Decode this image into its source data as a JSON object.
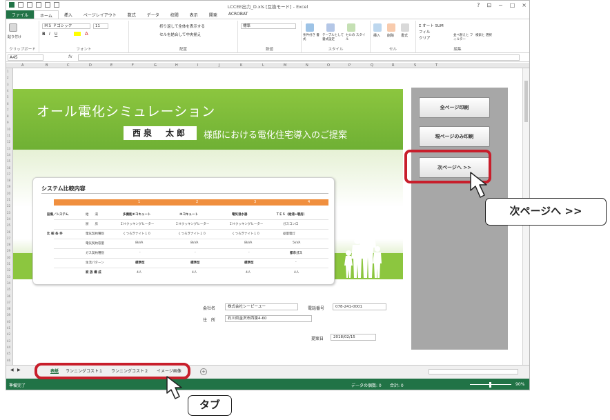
{
  "window": {
    "title": "LCCEE出力_D.xls [互換モード] - Excel",
    "controls": [
      "?",
      "⊡",
      "−",
      "□",
      "×"
    ]
  },
  "ribbon": {
    "tabs": [
      "ファイル",
      "ホーム",
      "挿入",
      "ページレイアウト",
      "数式",
      "データ",
      "校閲",
      "表示",
      "開発",
      "ACROBAT"
    ],
    "font_name": "ＭＳ Ｐゴシック",
    "font_size": "11",
    "number_format": "標準",
    "wrap_text": "折り返して全体を表示する",
    "merge_center": "セルを結合して中央揃え",
    "autosum": "オート SUM",
    "fill": "フィル",
    "clear": "クリア",
    "sort_filter": "並べ替えと フィルター",
    "find_select": "検索と 選択",
    "cond_format": "条件付き 書式",
    "format_table": "テーブルとして 書式設定",
    "cell_styles": "セルの スタイル",
    "insert": "挿入",
    "delete": "削除",
    "format": "書式",
    "groups": [
      "クリップボード",
      "フォント",
      "配置",
      "数値",
      "スタイル",
      "セル",
      "編集"
    ],
    "paste": "貼り付け"
  },
  "formula_bar": {
    "name_box": "A45",
    "fx": "fx",
    "value": ""
  },
  "column_headers": [
    "A",
    "B",
    "C",
    "D",
    "E",
    "F",
    "G",
    "H",
    "I",
    "J",
    "K",
    "L",
    "M",
    "N",
    "O",
    "P",
    "Q",
    "R",
    "S",
    "T"
  ],
  "row_numbers": [
    "1",
    "2",
    "3",
    "4",
    "5",
    "6",
    "7",
    "8",
    "9",
    "10",
    "11",
    "12",
    "13",
    "14",
    "15",
    "16",
    "17",
    "18",
    "19",
    "20",
    "21",
    "22",
    "23",
    "24",
    "25",
    "26",
    "27",
    "28",
    "29",
    "30",
    "31",
    "32",
    "33",
    "34",
    "35",
    "36",
    "37",
    "38",
    "39",
    "40",
    "41",
    "42",
    "43",
    "44",
    "45",
    "46"
  ],
  "sheet": {
    "main_title": "オール電化シミュレーション",
    "customer_name": "西泉　太郎",
    "subtitle": "様邸における電化住宅導入のご提案",
    "buttons": {
      "print_all": "全ページ印刷",
      "print_current": "現ページのみ印刷",
      "next_page": "次ページへ >>"
    },
    "comparison": {
      "title": "システム比較内容",
      "columns": [
        "1",
        "2",
        "3",
        "4"
      ],
      "row1_label": "設備／システム",
      "row1a_sub": "給　　湯",
      "row1a": [
        "多機能エコキュート",
        "エコキュート",
        "電気温水器",
        "ＴＥＳ（給湯+暖房）"
      ],
      "row1b_sub": "厨　　房",
      "row1b": [
        "ＩＨクッキングヒーター",
        "ＩＨクッキングヒーター",
        "ＩＨクッキングヒーター",
        "ガスコンロ"
      ],
      "row2_label": "比 較 条 件",
      "row2a_sub": "電気契約種別",
      "row2a": [
        "くつろぎナイト１０",
        "くつろぎナイト１０",
        "くつろぎナイト１０",
        "従量電灯"
      ],
      "row2b_sub": "電気契約容量",
      "row2b": [
        "8kVA",
        "8kVA",
        "8kVA",
        "5kVA"
      ],
      "row2c_sub": "ガス契約種別",
      "row2c": [
        "-",
        "-",
        "-",
        "都市ガス"
      ],
      "row2d_sub": "生活パターン",
      "row2d": [
        "標準型",
        "標準型",
        "標準型",
        "-"
      ],
      "row2e_sub": "家 族 構 成",
      "row2e": [
        "4人",
        "4人",
        "4人",
        "4人"
      ]
    },
    "info": {
      "company_label": "会社名",
      "company": "株式会社シーピーユー",
      "phone_label": "電話番号",
      "phone": "078-241-0001",
      "address_label": "住　所",
      "address": "石川県金沢市西泉4-60",
      "date_label": "提案日",
      "date": "2018/02/15"
    }
  },
  "sheet_tabs": [
    "表紙",
    "ランニングコスト１",
    "ランニングコスト２",
    "イメージ画像"
  ],
  "status_bar": {
    "ready": "準備完了",
    "data_count": "データの個数: 0",
    "sum": "合計: 0",
    "zoom": "90%"
  },
  "callouts": {
    "next_page": "次ページへ >>",
    "tabs": "タブ"
  },
  "colors": {
    "excel_green": "#217346",
    "banner_green": "#8cc63f",
    "highlight_red": "#c81e2b",
    "orange_header": "#f08f3e",
    "panel_gray": "#a7a7a7"
  }
}
